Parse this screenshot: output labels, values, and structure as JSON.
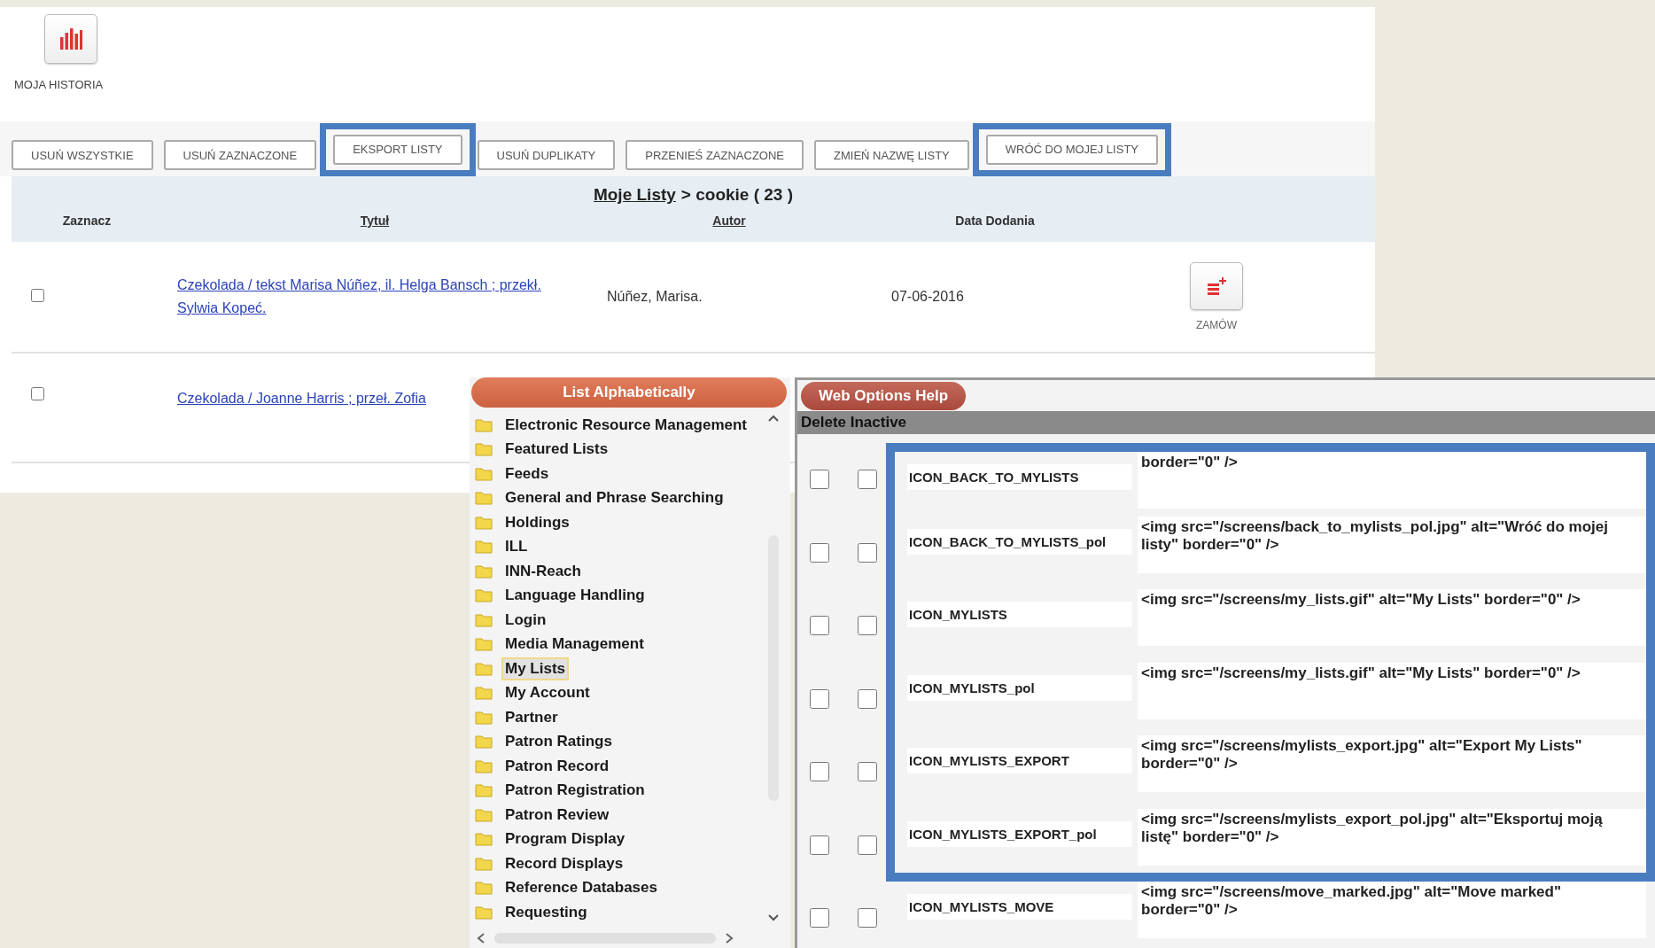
{
  "account_panel": {
    "history_label": "MOJA HISTORIA",
    "toolbar": [
      {
        "label": "USUŃ WSZYSTKIE",
        "highlighted": false
      },
      {
        "label": "USUŃ ZAZNACZONE",
        "highlighted": false
      },
      {
        "label": "EKSPORT LISTY",
        "highlighted": true
      },
      {
        "label": "USUŃ DUPLIKATY",
        "highlighted": false
      },
      {
        "label": "PRZENIEŚ ZAZNACZONE",
        "highlighted": false
      },
      {
        "label": "ZMIEŃ NAZWĘ LISTY",
        "highlighted": false
      },
      {
        "label": "WRÓĆ DO MOJEJ LISTY",
        "highlighted": true
      }
    ],
    "breadcrumb": {
      "link": "Moje Listy",
      "rest": "> cookie ( 23 )"
    },
    "columns": [
      "Zaznacz",
      "Tytuł",
      "Autor",
      "Data Dodania"
    ],
    "rows": [
      {
        "checked": false,
        "title": "Czekolada / tekst Marisa Núñez, il. Helga Bansch ; przekł. Sylwia Kopeć.",
        "author": "Núñez, Marisa.",
        "date": "07-06-2016",
        "action": "ZAMÓW"
      },
      {
        "checked": false,
        "title": "Czekolada / Joanne Harris ; przeł. Zofia"
      }
    ]
  },
  "category_panel": {
    "header": "List Alphabetically",
    "items": [
      {
        "label": "Electronic Resource Management",
        "selected": false
      },
      {
        "label": "Featured Lists",
        "selected": false
      },
      {
        "label": "Feeds",
        "selected": false
      },
      {
        "label": "General and Phrase Searching",
        "selected": false
      },
      {
        "label": "Holdings",
        "selected": false
      },
      {
        "label": "ILL",
        "selected": false
      },
      {
        "label": "INN-Reach",
        "selected": false
      },
      {
        "label": "Language Handling",
        "selected": false
      },
      {
        "label": "Login",
        "selected": false
      },
      {
        "label": "Media Management",
        "selected": false
      },
      {
        "label": "My Lists",
        "selected": true
      },
      {
        "label": "My Account",
        "selected": false
      },
      {
        "label": "Partner",
        "selected": false
      },
      {
        "label": "Patron Ratings",
        "selected": false
      },
      {
        "label": "Patron Record",
        "selected": false
      },
      {
        "label": "Patron Registration",
        "selected": false
      },
      {
        "label": "Patron Review",
        "selected": false
      },
      {
        "label": "Program Display",
        "selected": false
      },
      {
        "label": "Record Displays",
        "selected": false
      },
      {
        "label": "Reference Databases",
        "selected": false
      },
      {
        "label": "Requesting",
        "selected": false
      }
    ]
  },
  "options_panel": {
    "tab": "Web Options Help",
    "action_bar": "Delete Inactive",
    "rows": [
      {
        "checks": [
          false,
          false
        ],
        "name": "ICON_BACK_TO_MYLISTS",
        "value": "border=\"0\" />",
        "highlighted": true
      },
      {
        "checks": [
          false,
          false
        ],
        "name": "ICON_BACK_TO_MYLISTS_pol",
        "value": "<img src=\"/screens/back_to_mylists_pol.jpg\" alt=\"Wróć do mojej listy\" border=\"0\" />",
        "highlighted": true
      },
      {
        "checks": [
          false,
          false
        ],
        "name": "ICON_MYLISTS",
        "value": "<img src=\"/screens/my_lists.gif\" alt=\"My Lists\" border=\"0\" />",
        "highlighted": true
      },
      {
        "checks": [
          false,
          false
        ],
        "name": "ICON_MYLISTS_pol",
        "value": "<img src=\"/screens/my_lists.gif\" alt=\"My Lists\" border=\"0\" />",
        "highlighted": true
      },
      {
        "checks": [
          false,
          false
        ],
        "name": "ICON_MYLISTS_EXPORT",
        "value": "<img src=\"/screens/mylists_export.jpg\" alt=\"Export My Lists\" border=\"0\" />",
        "highlighted": true
      },
      {
        "checks": [
          false,
          false
        ],
        "name": "ICON_MYLISTS_EXPORT_pol",
        "value": "<img src=\"/screens/mylists_export_pol.jpg\" alt=\"Eksportuj moją listę\" border=\"0\" />",
        "highlighted": true
      },
      {
        "checks": [
          false,
          false
        ],
        "name": "ICON_MYLISTS_MOVE",
        "value": "<img src=\"/screens/move_marked.jpg\" alt=\"Move marked\" border=\"0\" />",
        "highlighted": false
      }
    ]
  }
}
